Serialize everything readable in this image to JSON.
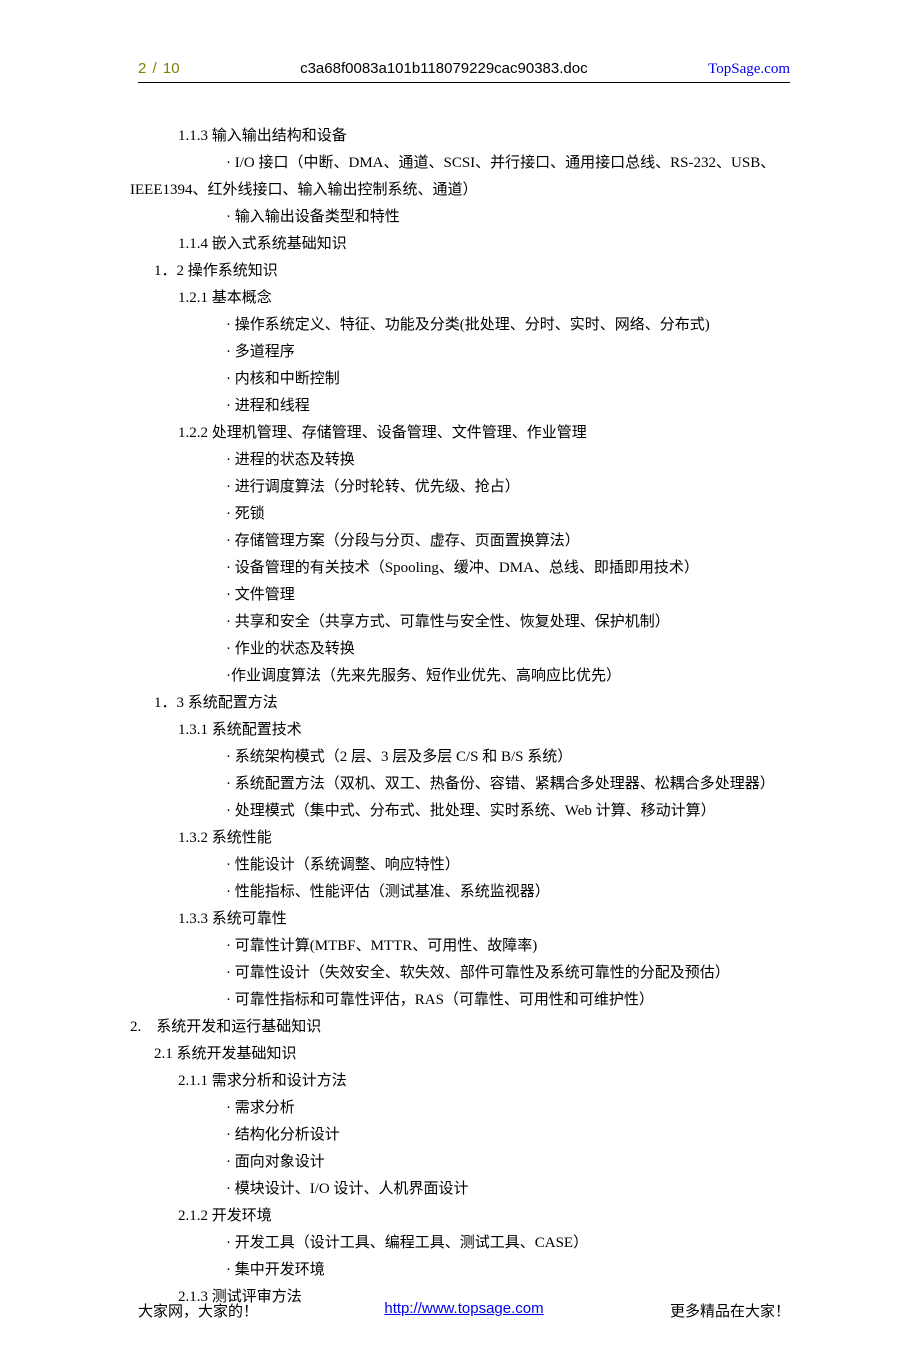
{
  "header": {
    "page_current": "2",
    "page_sep": "/",
    "page_total": "10",
    "filename": "c3a68f0083a101b118079229cac90383.doc",
    "site": "TopSage.com"
  },
  "footer": {
    "left": "大家网，大家的！",
    "link": "http://www.topsage.com",
    "right": "更多精品在大家！"
  },
  "lines": [
    {
      "cls": "i1",
      "t": "1.1.3 输入输出结构和设备"
    },
    {
      "cls": "i3",
      "t": "· I/O 接口（中断、DMA、通道、SCSI、并行接口、通用接口总线、RS-232、USB、IEEE1394、红外线接口、输入输出控制系统、通道）",
      "wrap": true
    },
    {
      "cls": "i3",
      "t": "· 输入输出设备类型和特性"
    },
    {
      "cls": "i1",
      "t": "1.1.4 嵌入式系统基础知识"
    },
    {
      "cls": "i4",
      "t": "1．2 操作系统知识"
    },
    {
      "cls": "i1",
      "t": "1.2.1 基本概念"
    },
    {
      "cls": "i3",
      "t": "· 操作系统定义、特征、功能及分类(批处理、分时、实时、网络、分布式)"
    },
    {
      "cls": "i3",
      "t": "· 多道程序"
    },
    {
      "cls": "i3",
      "t": "· 内核和中断控制"
    },
    {
      "cls": "i3",
      "t": "· 进程和线程"
    },
    {
      "cls": "i1",
      "t": "1.2.2 处理机管理、存储管理、设备管理、文件管理、作业管理"
    },
    {
      "cls": "i3",
      "t": "· 进程的状态及转换"
    },
    {
      "cls": "i3",
      "t": "· 进行调度算法（分时轮转、优先级、抢占）"
    },
    {
      "cls": "i3",
      "t": "· 死锁"
    },
    {
      "cls": "i3",
      "t": "· 存储管理方案（分段与分页、虚存、页面置换算法）"
    },
    {
      "cls": "i3",
      "t": "· 设备管理的有关技术（Spooling、缓冲、DMA、总线、即插即用技术）"
    },
    {
      "cls": "i3",
      "t": "· 文件管理"
    },
    {
      "cls": "i3",
      "t": "· 共享和安全（共享方式、可靠性与安全性、恢复处理、保护机制）"
    },
    {
      "cls": "i3",
      "t": "· 作业的状态及转换"
    },
    {
      "cls": "i3",
      "t": "·作业调度算法（先来先服务、短作业优先、高响应比优先）"
    },
    {
      "cls": "i4",
      "t": "1．3 系统配置方法"
    },
    {
      "cls": "i1",
      "t": "1.3.1 系统配置技术"
    },
    {
      "cls": "i3",
      "t": "· 系统架构模式（2 层、3 层及多层 C/S 和 B/S 系统）"
    },
    {
      "cls": "i3",
      "t": "· 系统配置方法（双机、双工、热备份、容错、紧耦合多处理器、松耦合多处理器）"
    },
    {
      "cls": "i3",
      "t": "· 处理模式（集中式、分布式、批处理、实时系统、Web 计算、移动计算）"
    },
    {
      "cls": "i1",
      "t": "1.3.2 系统性能"
    },
    {
      "cls": "i3",
      "t": "· 性能设计（系统调整、响应特性）"
    },
    {
      "cls": "i3",
      "t": "· 性能指标、性能评估（测试基准、系统监视器）"
    },
    {
      "cls": "i1",
      "t": "1.3.3 系统可靠性"
    },
    {
      "cls": "i3",
      "t": "· 可靠性计算(MTBF、MTTR、可用性、故障率)"
    },
    {
      "cls": "i3",
      "t": "· 可靠性设计（失效安全、软失效、部件可靠性及系统可靠性的分配及预估）"
    },
    {
      "cls": "i3",
      "t": "· 可靠性指标和可靠性评估，RAS（可靠性、可用性和可维护性）"
    },
    {
      "cls": "i0",
      "t": "2.　系统开发和运行基础知识"
    },
    {
      "cls": "i4",
      "t": "2.1 系统开发基础知识"
    },
    {
      "cls": "i1",
      "t": "2.1.1 需求分析和设计方法"
    },
    {
      "cls": "i3",
      "t": "· 需求分析"
    },
    {
      "cls": "i3",
      "t": "· 结构化分析设计"
    },
    {
      "cls": "i3",
      "t": "· 面向对象设计"
    },
    {
      "cls": "i3",
      "t": "· 模块设计、I/O 设计、人机界面设计"
    },
    {
      "cls": "i1",
      "t": "2.1.2 开发环境"
    },
    {
      "cls": "i3",
      "t": "· 开发工具（设计工具、编程工具、测试工具、CASE）"
    },
    {
      "cls": "i3",
      "t": "· 集中开发环境"
    },
    {
      "cls": "i1",
      "t": "2.1.3 测试评审方法"
    }
  ]
}
